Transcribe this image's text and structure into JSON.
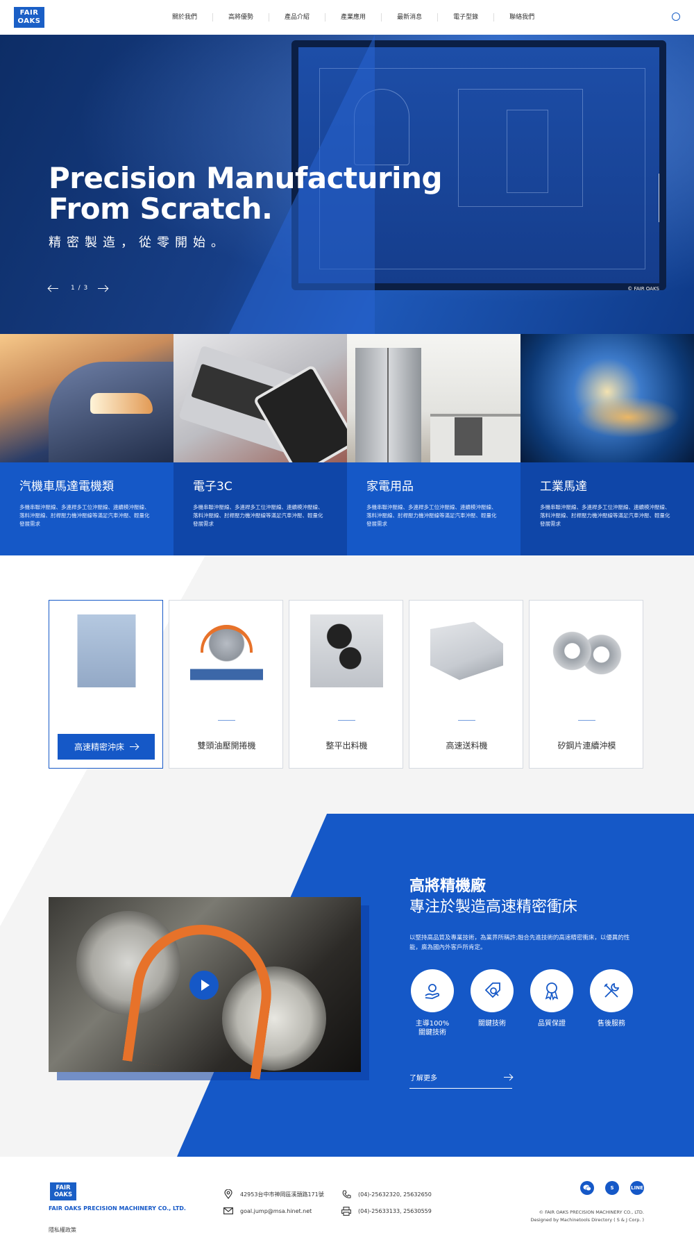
{
  "header": {
    "logo_line1": "FAIR",
    "logo_line2": "OAKS",
    "nav": [
      "關於我們",
      "高將優勢",
      "產品介紹",
      "產業應用",
      "最新消息",
      "電子型錄",
      "聯絡我們"
    ],
    "language_icon": "globe-icon"
  },
  "hero": {
    "title_line1": "Precision Manufacturing",
    "title_line2": "From Scratch.",
    "subtitle": "精密製造，從零開始。",
    "page_indicator": "1 / 3",
    "copyright": "© FAIR OAKS"
  },
  "industries": [
    {
      "title": "汽機車馬達電機類",
      "desc": "多機串聯沖壓線、多連桿多工位沖壓線、連續模沖壓線、落料沖壓線、肘桿壓力機沖壓線等滿足汽車沖壓、輕量化發展需求"
    },
    {
      "title": "電子3C",
      "desc": "多機串聯沖壓線、多連桿多工位沖壓線、連續模沖壓線、落料沖壓線、肘桿壓力機沖壓線等滿足汽車沖壓、輕量化發展需求"
    },
    {
      "title": "家電用品",
      "desc": "多機串聯沖壓線、多連桿多工位沖壓線、連續模沖壓線、落料沖壓線、肘桿壓力機沖壓線等滿足汽車沖壓、輕量化發展需求"
    },
    {
      "title": "工業馬達",
      "desc": "多機串聯沖壓線、多連桿多工位沖壓線、連續模沖壓線、落料沖壓線、肘桿壓力機沖壓線等滿足汽車沖壓、輕量化發展需求"
    }
  ],
  "products": [
    {
      "label": "高速精密沖床",
      "active": true
    },
    {
      "label": "雙頭油壓開捲機",
      "active": false
    },
    {
      "label": "整平出料機",
      "active": false
    },
    {
      "label": "高速送料機",
      "active": false
    },
    {
      "label": "矽鋼片連續沖模",
      "active": false
    }
  ],
  "about": {
    "heading": "高將精機廠",
    "subheading": "專注於製造高速精密衝床",
    "desc": "以堅持高品質及專業技術，為業界所稱許;融合先進技術的高速精密衝床，以優異的性能，廣為國內外客戶所肯定。",
    "features": [
      {
        "label_line1": "主導100%",
        "label_line2": "關鍵技術",
        "icon": "hand-gear-icon"
      },
      {
        "label_line1": "關鍵技術",
        "label_line2": "",
        "icon": "search-tag-icon"
      },
      {
        "label_line1": "品質保證",
        "label_line2": "",
        "icon": "award-icon"
      },
      {
        "label_line1": "售後服務",
        "label_line2": "",
        "icon": "tools-icon"
      }
    ],
    "more_label": "了解更多"
  },
  "footer": {
    "logo_line1": "FAIR",
    "logo_line2": "OAKS",
    "company": "FAIR OAKS PRECISION MACHINERY CO., LTD.",
    "privacy": "隱私權政策",
    "address": "42953台中市神岡區溪頭路171號",
    "email": "goal.jump@msa.hinet.net",
    "phone": "(04)-25632320, 25632650",
    "fax": "(04)-25633133, 25630559",
    "social": [
      "wechat-icon",
      "skype-icon",
      "line-icon"
    ],
    "social_labels": {
      "skype": "S",
      "line": "LINE"
    },
    "copyright": "© FAIR OAKS PRECISION MACHINERY CO., LTD.",
    "designer": "Designed by Machinetools Directory ( S & J Corp. )"
  }
}
